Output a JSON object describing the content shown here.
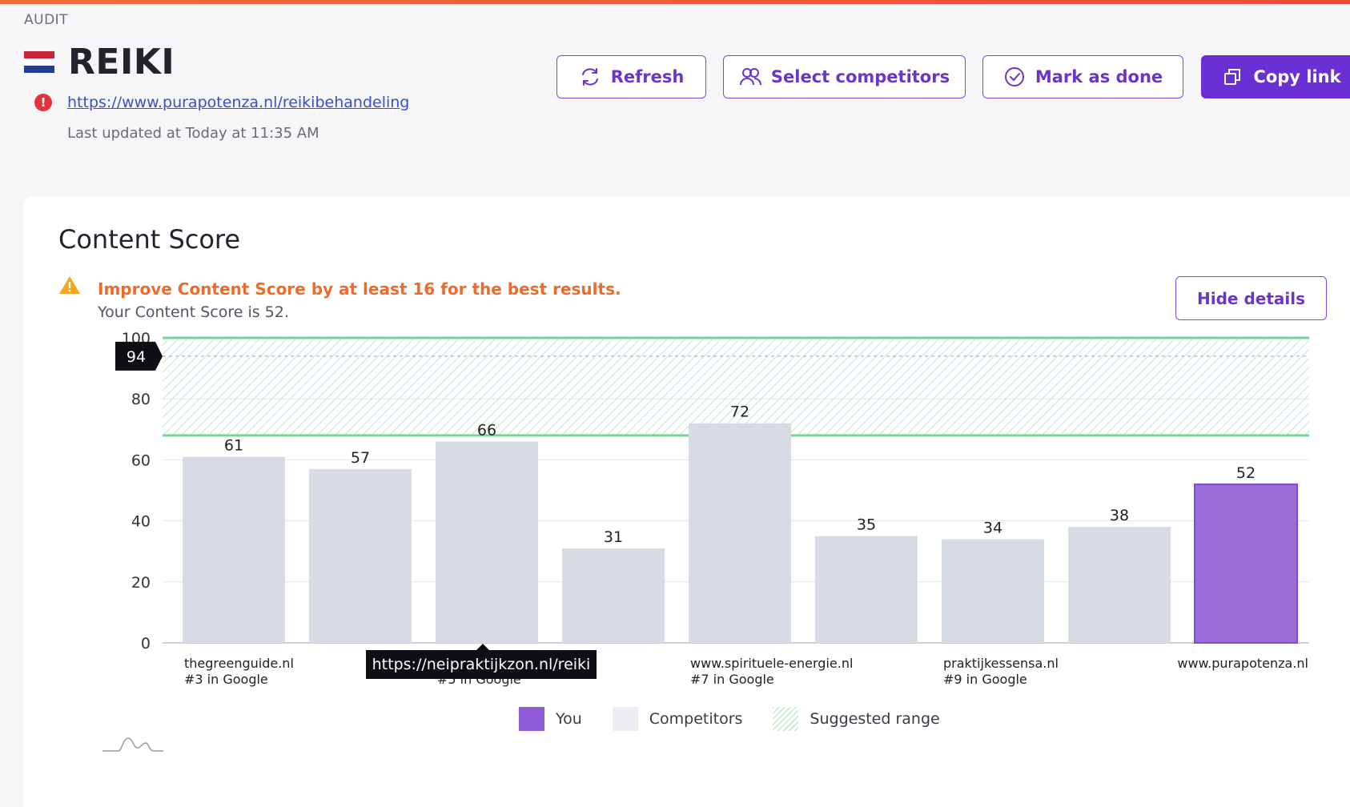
{
  "header": {
    "crumb": "AUDIT",
    "title": "REIKI",
    "url": "https://www.purapotenza.nl/reikibehandeling",
    "last_updated": "Last updated at Today at 11:35 AM",
    "error_glyph": "!"
  },
  "actions": {
    "refresh": "Refresh",
    "select_competitors": "Select competitors",
    "mark_done": "Mark as done",
    "copy_link": "Copy link"
  },
  "content_score": {
    "title": "Content Score",
    "warning": "Improve Content Score by at least 16 for the best results.",
    "score_line": "Your Content Score is 52.",
    "hide_details": "Hide details"
  },
  "tooltip": {
    "text": "https://neipraktijkzon.nl/reiki"
  },
  "legend": {
    "you": "You",
    "competitors": "Competitors",
    "suggested": "Suggested range"
  },
  "chart_data": {
    "type": "bar",
    "ylim": [
      0,
      100
    ],
    "yticks": [
      0,
      20,
      40,
      60,
      80,
      100
    ],
    "suggested_range": [
      68,
      100
    ],
    "target_marker": 94,
    "grid": true,
    "bars": [
      {
        "value": 61,
        "label": [
          "thegreenguide.nl",
          "#3 in Google"
        ],
        "you": false
      },
      {
        "value": 57,
        "label": [],
        "you": false
      },
      {
        "value": 66,
        "label": [
          "",
          "#5 in Google"
        ],
        "you": false
      },
      {
        "value": 31,
        "label": [],
        "you": false
      },
      {
        "value": 72,
        "label": [
          "www.spirituele-energie.nl",
          "#7 in Google"
        ],
        "you": false
      },
      {
        "value": 35,
        "label": [],
        "you": false
      },
      {
        "value": 34,
        "label": [
          "praktijkessensa.nl",
          "#9 in Google"
        ],
        "you": false
      },
      {
        "value": 38,
        "label": [],
        "you": false
      },
      {
        "value": 52,
        "label": [
          "www.purapotenza.nl"
        ],
        "you": true
      }
    ],
    "colors": {
      "competitor": "#d6dbe4",
      "you": "#9b6cd8",
      "you_border": "#7d4bd6",
      "range_line": "#74d594",
      "range_hatch": "#bfe8cd"
    }
  }
}
